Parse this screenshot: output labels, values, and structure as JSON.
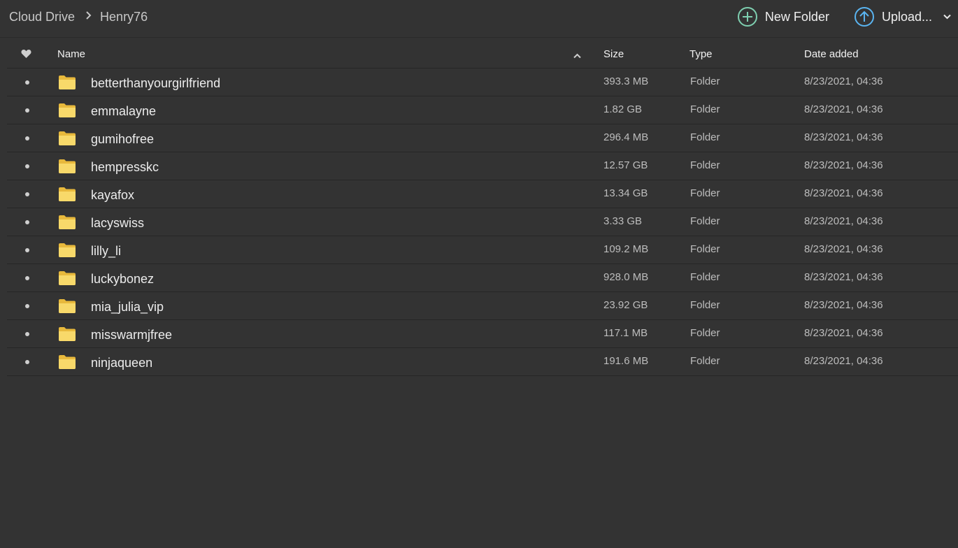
{
  "breadcrumb": {
    "root": "Cloud Drive",
    "current": "Henry76"
  },
  "actions": {
    "new_folder": "New Folder",
    "upload": "Upload..."
  },
  "colors": {
    "new_folder_accent": "#7ecfb0",
    "upload_accent": "#5ab4f0",
    "folder_yellow": "#f8d96a"
  },
  "table": {
    "headers": {
      "name": "Name",
      "size": "Size",
      "type": "Type",
      "date": "Date added"
    },
    "rows": [
      {
        "name": "betterthanyourgirlfriend",
        "size": "393.3 MB",
        "type": "Folder",
        "date": "8/23/2021, 04:36"
      },
      {
        "name": "emmalayne",
        "size": "1.82 GB",
        "type": "Folder",
        "date": "8/23/2021, 04:36"
      },
      {
        "name": "gumihofree",
        "size": "296.4 MB",
        "type": "Folder",
        "date": "8/23/2021, 04:36"
      },
      {
        "name": "hempresskc",
        "size": "12.57 GB",
        "type": "Folder",
        "date": "8/23/2021, 04:36"
      },
      {
        "name": "kayafox",
        "size": "13.34 GB",
        "type": "Folder",
        "date": "8/23/2021, 04:36"
      },
      {
        "name": "lacyswiss",
        "size": "3.33 GB",
        "type": "Folder",
        "date": "8/23/2021, 04:36"
      },
      {
        "name": "lilly_li",
        "size": "109.2 MB",
        "type": "Folder",
        "date": "8/23/2021, 04:36"
      },
      {
        "name": "luckybonez",
        "size": "928.0 MB",
        "type": "Folder",
        "date": "8/23/2021, 04:36"
      },
      {
        "name": "mia_julia_vip",
        "size": "23.92 GB",
        "type": "Folder",
        "date": "8/23/2021, 04:36"
      },
      {
        "name": "misswarmjfree",
        "size": "117.1 MB",
        "type": "Folder",
        "date": "8/23/2021, 04:36"
      },
      {
        "name": "ninjaqueen",
        "size": "191.6 MB",
        "type": "Folder",
        "date": "8/23/2021, 04:36"
      }
    ]
  }
}
